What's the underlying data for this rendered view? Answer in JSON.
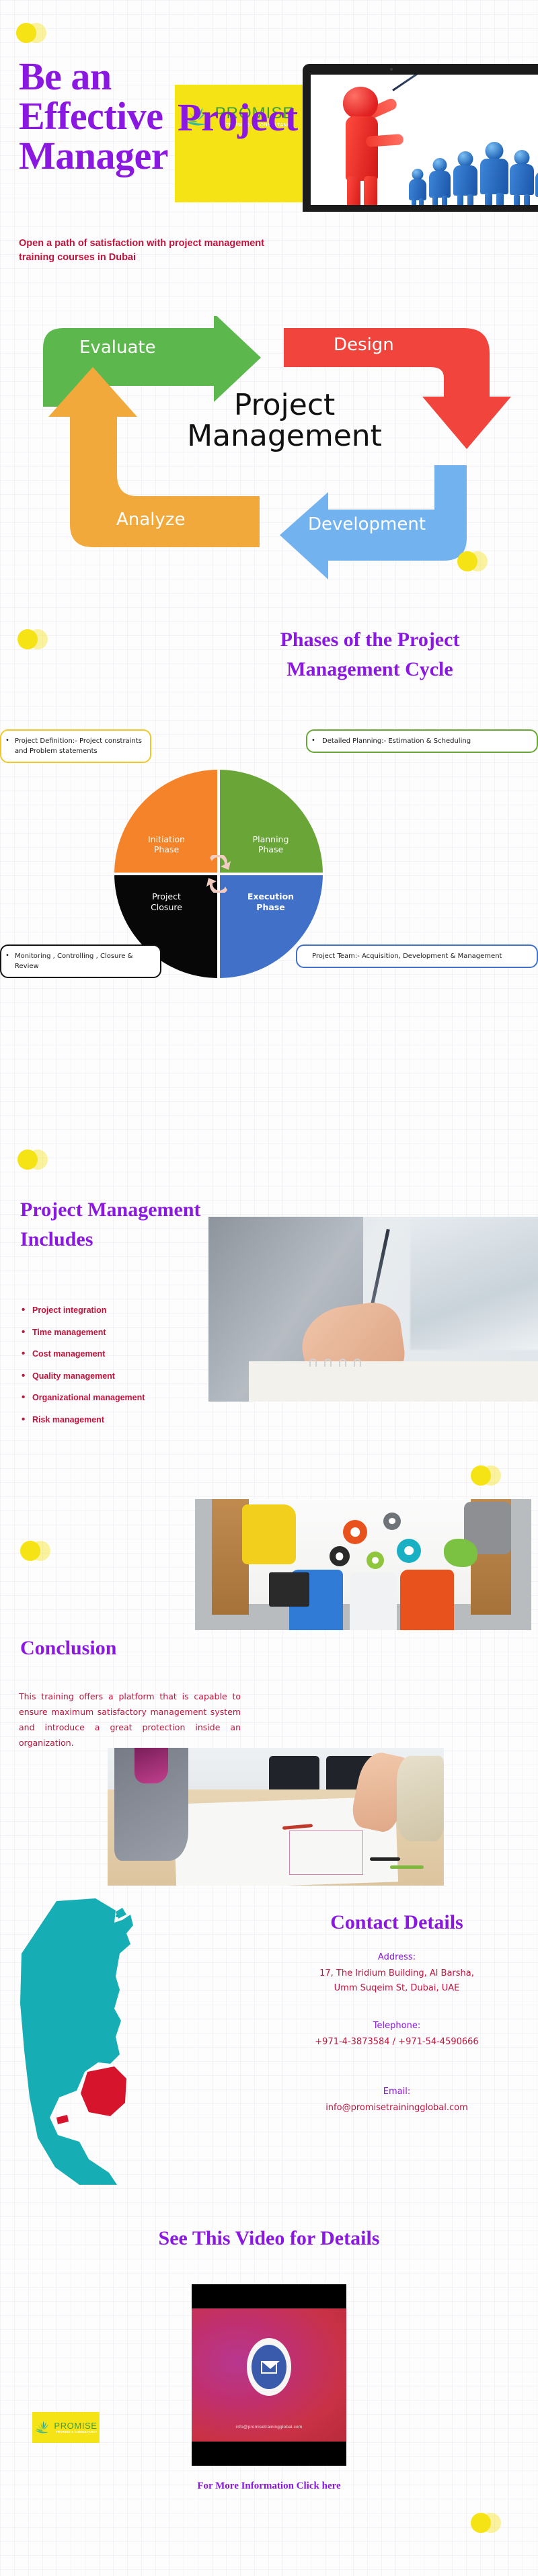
{
  "hero": {
    "title_lines": [
      "Be an",
      "Effective",
      "Manager"
    ],
    "overlay_word": "Project",
    "subtitle": "Open a path of satisfaction with project management training courses in Dubai",
    "brand": {
      "name": "PROMISE",
      "tagline": "TRAINING & CONSULTANCY"
    },
    "image_alt": "trainer-pointing-at-audience"
  },
  "cycle": {
    "center_line1": "Project",
    "center_line2": "Management",
    "steps": [
      {
        "label": "Evaluate",
        "color": "#5cb84c",
        "position": "top-left"
      },
      {
        "label": "Design",
        "color": "#f0443c",
        "position": "top-right"
      },
      {
        "label": "Development",
        "color": "#72b3ef",
        "position": "bottom-right"
      },
      {
        "label": "Analyze",
        "color": "#f2a93b",
        "position": "bottom-left"
      }
    ]
  },
  "phases": {
    "heading_line1": "Phases of the Project",
    "heading_line2": "Management Cycle",
    "quadrants": [
      {
        "label_line1": "Initiation",
        "label_line2": "Phase",
        "color": "#f5832a"
      },
      {
        "label_line1": "Planning",
        "label_line2": "Phase",
        "color": "#6aa637"
      },
      {
        "label_line1": "Project",
        "label_line2": "Closure",
        "color": "#070707"
      },
      {
        "label_line1": "Execution",
        "label_line2": "Phase",
        "color": "#4070c8"
      }
    ],
    "callouts": [
      {
        "bullet": "•",
        "text": "Project Definition:- Project constraints and Problem statements",
        "border_color": "#efc827"
      },
      {
        "bullet": "•",
        "text": "Detailed Planning:- Estimation & Scheduling",
        "border_color": "#6aa637"
      },
      {
        "bullet": "•",
        "text": "Monitoring , Controlling , Closure & Review",
        "border_color": "#111111"
      },
      {
        "bullet": "",
        "text": "Project Team:- Acquisition, Development & Management",
        "border_color": "#4070c8"
      }
    ]
  },
  "includes": {
    "heading_line1": "Project Management",
    "heading_line2": "Includes",
    "items": [
      "Project integration",
      "Time management",
      "Cost management",
      "Quality management",
      "Organizational management",
      "Risk management"
    ],
    "image_alt": "hand-writing-on-notepad"
  },
  "conclusion": {
    "heading": "Conclusion",
    "body": "This training offers a platform that is capable to ensure maximum satisfactory management system and introduce a great protection inside an organization.",
    "image_alt": "team-around-table-with-gears-poster"
  },
  "meeting": {
    "image_alt": "team-reviewing-blueprints-on-table"
  },
  "contact": {
    "heading": "Contact Details",
    "address_label": "Address:",
    "address_line1": "17, The Iridium Building, Al Barsha,",
    "address_line2": "Umm Suqeim St, Dubai, UAE",
    "telephone_label": "Telephone:",
    "telephone_value": "+971-4-3873584 / +971-54-4590666",
    "email_label": "Email:",
    "email_value": "info@promisetrainingglobal.com",
    "map_alt": "uae-map-dubai-highlighted",
    "map_color": "#16aeb4",
    "map_highlight_color": "#d6142c"
  },
  "video": {
    "heading": "See This Video for Details",
    "overlay_email": "info@promisetrainingglobal.com",
    "cta": "For More Information Click here",
    "brand": {
      "name": "PROMISE",
      "tagline": "TRAINING & CONSULTANCY"
    }
  },
  "theme": {
    "purple": "#8a18e0",
    "crimson": "#c0143c",
    "yellow": "#f5e316",
    "green": "#3f9c3a"
  }
}
